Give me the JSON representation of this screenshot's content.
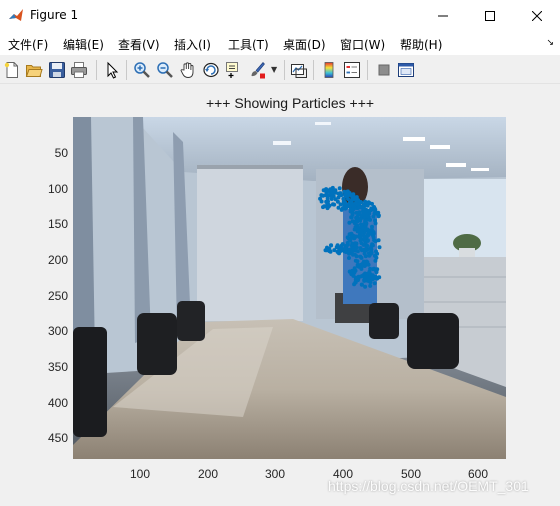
{
  "window": {
    "title": "Figure 1"
  },
  "menu": {
    "items": [
      {
        "label": "文件(F)"
      },
      {
        "label": "编辑(E)"
      },
      {
        "label": "查看(V)"
      },
      {
        "label": "插入(I)"
      },
      {
        "label": "工具(T)"
      },
      {
        "label": "桌面(D)"
      },
      {
        "label": "窗口(W)"
      },
      {
        "label": "帮助(H)"
      }
    ],
    "overflow_glyph": "↘"
  },
  "toolbar": {
    "icons": [
      "new-figure-icon",
      "open-file-icon",
      "save-icon",
      "print-icon",
      "pointer-icon",
      "zoom-in-icon",
      "zoom-out-icon",
      "pan-hand-icon",
      "rotate-3d-icon",
      "data-cursor-icon",
      "brush-icon",
      "link-plot-icon",
      "colorbar-icon",
      "legend-icon",
      "hide-plot-tools-icon",
      "show-plot-tools-icon"
    ]
  },
  "axes": {
    "title": "+++ Showing Particles +++",
    "yticks": [
      "50",
      "100",
      "150",
      "200",
      "250",
      "300",
      "350",
      "400",
      "450"
    ],
    "xticks": [
      "100",
      "200",
      "300",
      "400",
      "500",
      "600"
    ],
    "xlim": [
      1,
      640
    ],
    "ylim": [
      1,
      480
    ],
    "y_direction": "reversed",
    "particle_color": "#0072bd"
  },
  "watermark": {
    "text": "https://blog.csdn.net/OEMT_301"
  }
}
